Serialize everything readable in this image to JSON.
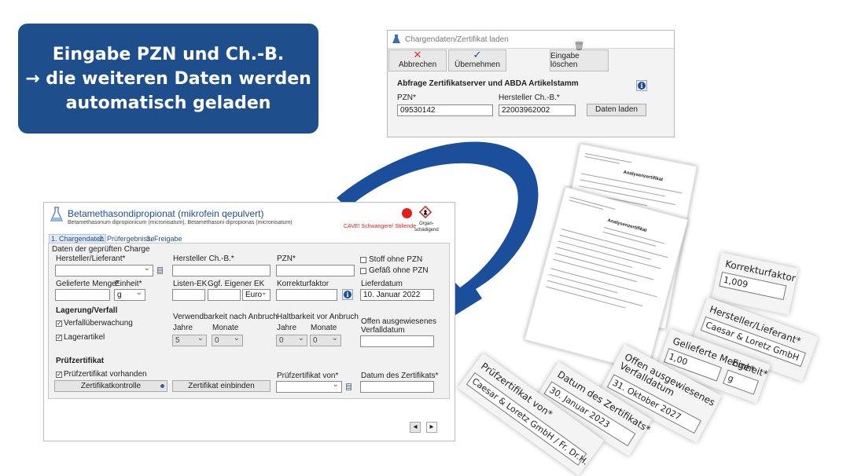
{
  "callout": {
    "line1": "Eingabe PZN und Ch.-B.",
    "line2": "→ die weiteren Daten werden",
    "line3": "automatisch geladen"
  },
  "load_dialog": {
    "title": "Chargendaten/Zertifikat laden",
    "buttons": {
      "cancel": "Abbrechen",
      "accept": "Übernehmen",
      "clear": "Eingabe löschen"
    },
    "section": "Abfrage Zertifikatserver und ABDA Artikelstamm",
    "pzn_label": "PZN*",
    "pzn_value": "09530142",
    "batch_label": "Hersteller Ch.-B.*",
    "batch_value": "22003962002",
    "load_button": "Daten laden"
  },
  "main_window": {
    "title": "Betamethasondipropionat (mikrofein qepulvert)",
    "subtitle": "Betamethasonum dipropionicum (micronisatum), Betamethasoni dipropionas (micronisatum)",
    "warning": "CAVE! Schwangere/ Stillende",
    "hazard_label1": "Organ-",
    "hazard_label2": "schädigend",
    "tabs": [
      "1. Chargendaten",
      "2. Prüfergebnisse",
      "3. Freigabe"
    ],
    "group_title": "Daten der geprüften Charge",
    "manufacturer_label": "Hersteller/Lieferant*",
    "manufacturer_batch_label": "Hersteller Ch.-B.*",
    "pzn_label": "PZN*",
    "no_pzn": "Stoff ohne PZN",
    "vessel_no_pzn": "Gefäß ohne PZN",
    "delivered_qty_label": "Gelieferte Menge*",
    "unit_label": "Einheit*",
    "unit_value": "g",
    "list_ek_label": "Listen-EK",
    "own_ek_label": "Ggf. Eigener EK",
    "currency_value": "Euro",
    "correction_label": "Korrekturfaktor",
    "delivery_date_label": "Lieferdatum",
    "delivery_date_value": "10. Januar 2022",
    "storage_title": "Lagerung/Verfall",
    "expiry_monitoring": "Verfallüberwachung",
    "stock_item": "Lagerartikel",
    "usable_after_opening": "Verwendbarkeit nach Anbruch",
    "shelf_after_opening": "Haltbarkeit vor Anbruch",
    "years": "Jahre",
    "months": "Monate",
    "years_value1": "5",
    "months_value1": "0",
    "years_value2": "0",
    "months_value2": "0",
    "open_expiry_label1": "Offen ausgewiesenes",
    "open_expiry_label2": "Verfalldatum",
    "cert_title": "Prüfzertifikat",
    "cert_present": "Prüfzertifikat vorhanden",
    "cert_check_button": "Zertifikatkontrolle",
    "cert_embed_button": "Zertifikat einbinden",
    "cert_from_label": "Prüfzertifikat von*",
    "cert_date_label": "Datum des Zertifikats*"
  },
  "documents": {
    "title1": "Analysenzertifikat",
    "title2": "Analysenzertifikat"
  },
  "cards": {
    "correction": {
      "label": "Korrekturfaktor",
      "value": "1,009"
    },
    "manufacturer": {
      "label": "Hersteller/Lieferant*",
      "value": "Caesar & Loretz GmbH"
    },
    "quantity": {
      "label": "Gelieferte Menge*",
      "value": "1,00"
    },
    "unit": {
      "label": "Einheit*",
      "value": "g"
    },
    "open_expiry": {
      "label1": "Offen ausgewiesenes",
      "label2": "Verfalldatum",
      "value": "31. Oktober 2027"
    },
    "cert_date": {
      "label": "Datum des Zertifikats*",
      "value": "30. Januar 2023"
    },
    "cert_from": {
      "label": "Prüfzertifikat von*",
      "value": "Caesar & Loretz GmbH / Fr. Dr.H."
    }
  },
  "colors": {
    "brand_blue": "#1f4e8c",
    "arrow_blue": "#1b4f9c",
    "warning_red": "#e0201b"
  }
}
